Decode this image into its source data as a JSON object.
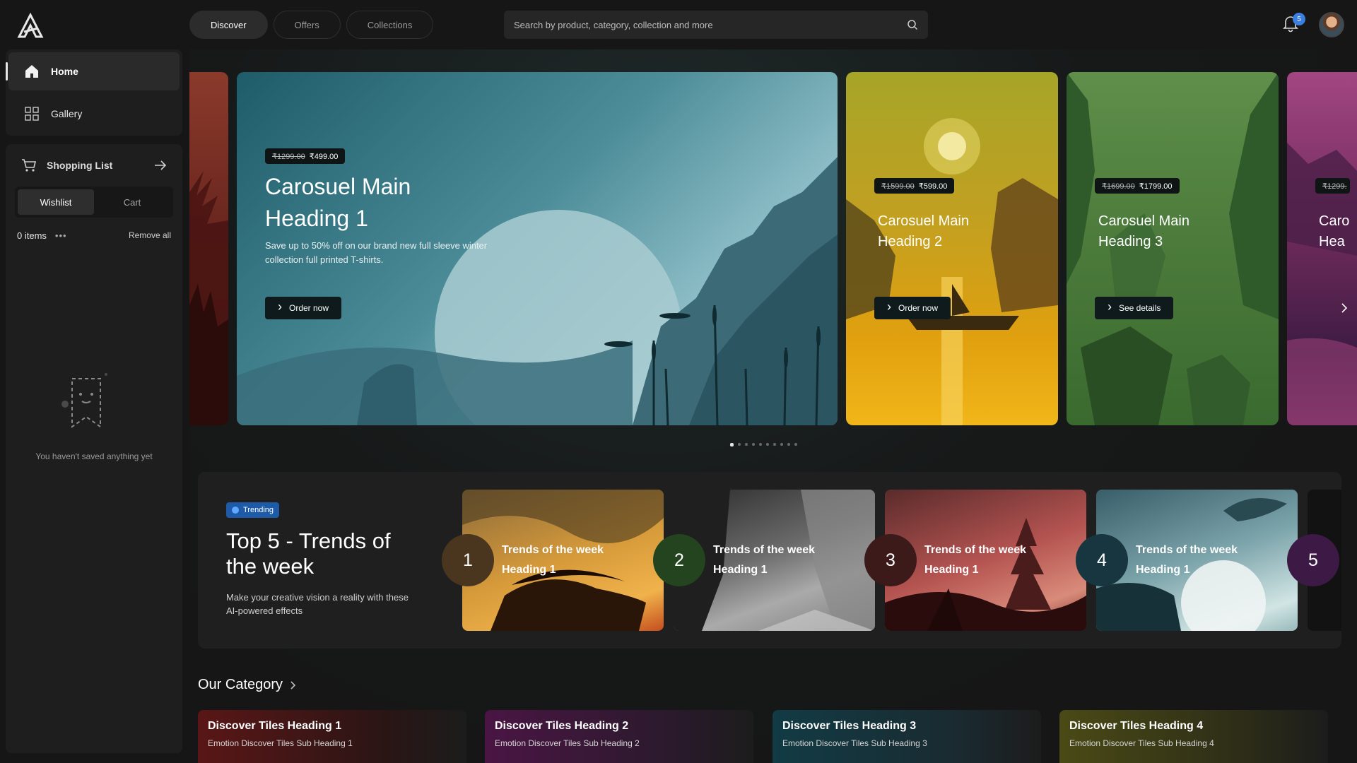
{
  "header": {
    "tabs": [
      {
        "label": "Discover",
        "active": true
      },
      {
        "label": "Offers",
        "active": false
      },
      {
        "label": "Collections",
        "active": false
      }
    ],
    "search_placeholder": "Search by product, category, collection and more",
    "notification_count": "5"
  },
  "sidebar": {
    "nav": [
      {
        "label": "Home",
        "icon": "home-icon",
        "active": true
      },
      {
        "label": "Gallery",
        "icon": "grid-icon",
        "active": false
      }
    ],
    "shopping": {
      "title": "Shopping List",
      "segments": [
        "Wishlist",
        "Cart"
      ],
      "active_segment": "Wishlist",
      "items_count": "0 items",
      "more": "•••",
      "remove_all": "Remove all",
      "empty_message": "You haven't saved anything yet"
    }
  },
  "carousel": {
    "main": {
      "old_price": "₹1299.00",
      "price": "₹499.00",
      "heading": "Carosuel Main Heading 1",
      "description": "Save up to 50% off on our brand new full sleeve winter collection full printed T-shirts.",
      "cta": "Order now"
    },
    "card2": {
      "old_price": "₹1599.00",
      "price": "₹599.00",
      "heading": "Carosuel Main Heading 2",
      "cta": "Order now"
    },
    "card3": {
      "old_price": "₹1699.00",
      "price": "₹1799.00",
      "heading": "Carosuel Main Heading 3",
      "cta": "See details"
    },
    "card_right": {
      "old_price": "₹1299.",
      "heading_line1": "Caro",
      "heading_line2": "Hea"
    },
    "page_count": 10,
    "active_page": 1
  },
  "trending": {
    "badge": "Trending",
    "title": "Top 5 - Trends of the week",
    "description": "Make your creative vision a reality with these AI-powered effects",
    "items": [
      {
        "rank": "1",
        "label": "Trends of the week Heading 1"
      },
      {
        "rank": "2",
        "label": "Trends of the week Heading 1"
      },
      {
        "rank": "3",
        "label": "Trends of the week Heading 1"
      },
      {
        "rank": "4",
        "label": "Trends of the week Heading 1"
      },
      {
        "rank": "5",
        "label": ""
      }
    ]
  },
  "category": {
    "title": "Our Category",
    "tiles": [
      {
        "heading": "Discover Tiles Heading 1",
        "sub": "Emotion Discover Tiles Sub Heading 1"
      },
      {
        "heading": "Discover Tiles Heading 2",
        "sub": "Emotion Discover Tiles Sub Heading 2"
      },
      {
        "heading": "Discover Tiles Heading 3",
        "sub": "Emotion Discover Tiles Sub Heading 3"
      },
      {
        "heading": "Discover Tiles Heading 4",
        "sub": "Emotion Discover Tiles Sub Heading 4"
      }
    ]
  },
  "colors": {
    "background": "#161616",
    "panel": "#1e1e1e",
    "accent": "#3a7fe0"
  }
}
